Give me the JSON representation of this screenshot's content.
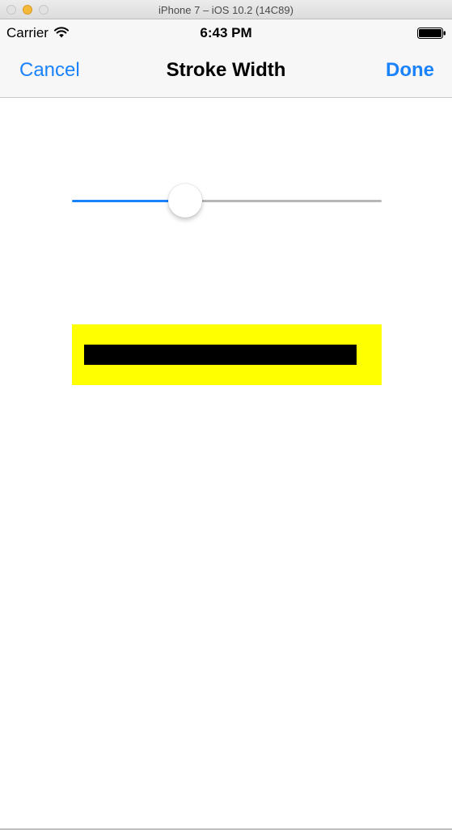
{
  "window": {
    "title": "iPhone 7 – iOS 10.2 (14C89)"
  },
  "status_bar": {
    "carrier": "Carrier",
    "time": "6:43 PM",
    "icons": [
      "wifi-icon",
      "battery-icon"
    ]
  },
  "nav_bar": {
    "cancel_label": "Cancel",
    "title": "Stroke Width",
    "done_label": "Done"
  },
  "slider": {
    "value_fraction": 0.35
  },
  "preview": {
    "background_color": "#ffff00",
    "stroke_color": "#000000"
  },
  "colors": {
    "accent": "#1a82fb",
    "minimize_button": "#f5b83a"
  }
}
